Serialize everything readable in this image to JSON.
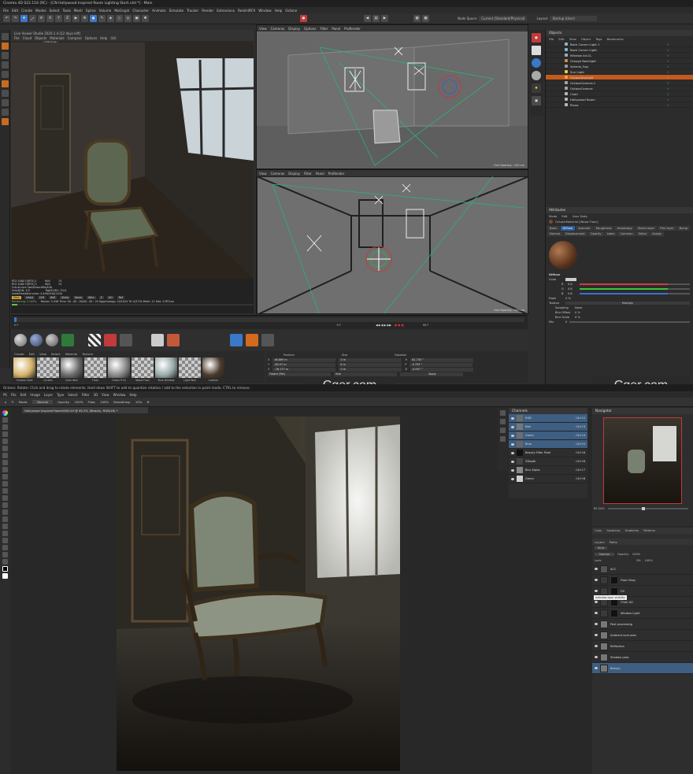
{
  "c4d": {
    "window_title": "Cinema 4D S22.116 (RC) - [CN Hollywood Inspired Room Lighting Start.c4d *] - Main",
    "menu": [
      "File",
      "Edit",
      "Create",
      "Modes",
      "Select",
      "Tools",
      "Mesh",
      "Spline",
      "Volume",
      "MoGraph",
      "Character",
      "Animate",
      "Simulate",
      "Tracker",
      "Render",
      "Extensions",
      "RedshiftFX",
      "Window",
      "Help",
      "Octane"
    ],
    "node_space_label": "Node Space:",
    "node_space_value": "Current (Standard/Physical)",
    "layout_label": "Layout:",
    "layout_value": "Startup (User)",
    "xyz": [
      "X",
      "Y",
      "Z"
    ],
    "live_viewer": {
      "title": "Live Viewer Studio 2020.1.4-[12 days left]",
      "menu": [
        "File",
        "Cloud",
        "Objects",
        "Materials",
        "Compare",
        "Options",
        "Help",
        "GUI"
      ],
      "dropdown": "LDR 8-bit",
      "status": [
        "RTX 2080 Ti[RTX] 1",
        "RTX 2080 Ti[RTX] 2",
        "Out-of-core used/max:0Kb/4Gb",
        "Grey8/16: 1/3",
        "Used/free/total vram: 4.4Gb/5Gb/11Gb"
      ],
      "gpu_pct": [
        "90%",
        "90%"
      ],
      "gpu_temp": [
        "74",
        "74"
      ],
      "rgb_label": "Rgb32/64: 7/1/4",
      "render_tabs": [
        "Main",
        "Infold",
        "Diff",
        "Refl",
        "Shdw",
        "Norm",
        "Wire",
        "Z",
        "AO",
        "Ref"
      ],
      "progress": "Rendering: 2.344%",
      "progress_value": 0.02344,
      "render_stats": "Ms/sec: 5.456   Time: 00 : 00 : 00/00 : 00 : 20   Spp/maxspp: 24/1024   Tri: 0/572k   Mesh: 11   Hair: 0   RTX:on"
    },
    "viewport_top": {
      "menu": [
        "View",
        "Cameras",
        "Display",
        "Options",
        "Filter",
        "Panel",
        "ProRender"
      ],
      "label": "Perspective",
      "camera": "OctaneCamera.1",
      "grid": "Grid Spacing : 100 cm"
    },
    "viewport_bottom": {
      "menu": [
        "View",
        "Cameras",
        "Display",
        "Filter",
        "Panel",
        "ProRender"
      ],
      "label": "Perspective",
      "grid": "Grid Spacing : 100 cm"
    },
    "objects_panel": {
      "title": "Objects",
      "menu": [
        "File",
        "Edit",
        "View",
        "Object",
        "Tags",
        "Bookmarks"
      ],
      "items": [
        {
          "name": "Back Corner Light 1",
          "color": "#8fb1c9"
        },
        {
          "name": "Back Corner Light",
          "color": "#8fb1c9"
        },
        {
          "name": "Window ArLCL",
          "color": "#8fb1c9"
        },
        {
          "name": "Orange Backlight",
          "color": "#d48a3a"
        },
        {
          "name": "Volume_Fog",
          "color": "#9a9a9a"
        },
        {
          "name": "Sun Light",
          "color": "#e6c84c"
        },
        {
          "name": "OctaneDaylight",
          "color": "#e8a43a"
        },
        {
          "name": "OctaneCamera.1",
          "color": "#a5a5a5"
        },
        {
          "name": "OctaneCamera",
          "color": "#a5a5a5"
        },
        {
          "name": "Chair",
          "color": "#b7b7b7"
        },
        {
          "name": "Hollywood Room",
          "color": "#b7b7b7"
        },
        {
          "name": "Plane",
          "color": "#b7b7b7"
        }
      ],
      "selected_index": 6
    },
    "attributes": {
      "title": "Attributes",
      "menu": [
        "Mode",
        "Edit",
        "User Data"
      ],
      "material": "OctaneMaterial [Wood Floor]",
      "tabs_row1": [
        "Basic",
        "Diffuse",
        "Specular",
        "Roughness",
        "Anisotropy",
        "Sheen layer",
        "Film layer"
      ],
      "tabs_row2": [
        "Bump",
        "Normal",
        "Displacement",
        "Opacity",
        "Index",
        "Common",
        "Editor"
      ],
      "tabs_row3": [
        "Assign"
      ],
      "active_tab": "Diffuse",
      "section": "Diffuse",
      "color_label": "Color",
      "rgb": [
        {
          "label": "R",
          "value": "0.8",
          "color": "#d23c3c"
        },
        {
          "label": "G",
          "value": "0.8",
          "color": "#3cc23c"
        },
        {
          "label": "B",
          "value": "0.8",
          "color": "#3c6ed2"
        }
      ],
      "float_label": "Float",
      "float_value": "0 %",
      "texture_label": "Texture",
      "texture_value": "Multiply",
      "sampling_label": "Sampling",
      "sampling_value": "None",
      "blur_offset_label": "Blur Offset",
      "blur_offset_value": "0 %",
      "blur_scale_label": "Blur Scale",
      "blur_scale_value": "0 %",
      "mix_label": "Mix",
      "mix_value": "0"
    },
    "timeline": {
      "start": "0 F",
      "end": "90 F",
      "current": "0 F"
    },
    "material_manager": {
      "menu": [
        "Create",
        "Edit",
        "View",
        "Select",
        "Material",
        "Texture"
      ],
      "materials": [
        "Chrome Gold",
        "Curtain",
        "Dark Wall",
        "Floor",
        "Green Trim",
        "Wood Floor",
        "Blue Window",
        "Light Wall",
        "Leather"
      ]
    },
    "coordinates": {
      "headers": [
        "Position",
        "Size",
        "Rotation"
      ],
      "rows": [
        {
          "axis": "X",
          "pos": "46.869 m",
          "size": "0 m",
          "rot_label": "H",
          "rot": "62.735 °"
        },
        {
          "axis": "Y",
          "pos": "-80.07 m",
          "size": "0 m",
          "rot_label": "P",
          "rot": "-9.793 °"
        },
        {
          "axis": "Z",
          "pos": "-76.177 m",
          "size": "0 m",
          "rot_label": "B",
          "rot": "-0.097 °"
        }
      ],
      "mode": "Object (Rel)",
      "size_mode": "Size",
      "apply": "Apply"
    },
    "status_hint": "Octane: Rotate: Click and drag to rotate elements. Hold down SHIFT to add to quantize rotation / add to the selection in point mode, CTRL to remove."
  },
  "watermarks": [
    "Cger.com",
    "Cger.com"
  ],
  "ps": {
    "menu": [
      "PS",
      "File",
      "Edit",
      "Image",
      "Layer",
      "Type",
      "Select",
      "Filter",
      "3D",
      "View",
      "Window",
      "Help"
    ],
    "options": {
      "mode_label": "Mode:",
      "mode_value": "Normal",
      "opacity_label": "Opacity:",
      "opacity_value": "100%",
      "flow_label": "Flow:",
      "flow_value": "100%",
      "smoothing_label": "Smoothing:",
      "smoothing_value": "10%"
    },
    "doc_tab": "Hollywood Inspired Room0000.tif @ 65.2% (Beauty, RGB/16) *",
    "zoom": "65.24%",
    "channels": {
      "title": "Channels",
      "rows": [
        {
          "name": "RGB",
          "key": "Ctrl+2",
          "sel": true,
          "thumb": "#6b6b6b"
        },
        {
          "name": "Red",
          "key": "Ctrl+3",
          "sel": true,
          "thumb": "#777"
        },
        {
          "name": "Green",
          "key": "Ctrl+4",
          "sel": true,
          "thumb": "#6e6e6e"
        },
        {
          "name": "Blue",
          "key": "Ctrl+5",
          "sel": true,
          "thumb": "#666"
        },
        {
          "name": "Beauty Filter Pixel",
          "key": "Ctrl+6",
          "sel": false,
          "thumb": "#111"
        },
        {
          "name": "ZDepth",
          "key": "Ctrl+6",
          "sel": false,
          "thumb": "#444"
        },
        {
          "name": "Blur Alpha",
          "key": "Ctrl+7",
          "sel": false,
          "thumb": "#888"
        },
        {
          "name": "Green",
          "key": "Ctrl+8",
          "sel": false,
          "thumb": "#cfcfcf"
        }
      ]
    },
    "navigator": {
      "title": "Navigator"
    },
    "panel_tabs": [
      "Color",
      "Swatches",
      "Gradients",
      "Patterns"
    ],
    "layers": {
      "tabs": [
        "Layers",
        "Paths"
      ],
      "kind": "Kind",
      "blend": "Normal",
      "opacity_label": "Opacity:",
      "opacity": "100%",
      "fill_label": "Fill:",
      "fill": "100%",
      "lock_label": "Lock:",
      "tooltip": "Indicates layer visibility",
      "rows": [
        {
          "name": "ACC",
          "sel": false,
          "mask": false
        },
        {
          "name": "Floor Drop",
          "sel": false,
          "mask": true
        },
        {
          "name": "Fill",
          "sel": false,
          "mask": true
        },
        {
          "name": "Chair AO",
          "sel": false,
          "mask": true
        },
        {
          "name": "Window Light",
          "sel": false,
          "mask": true
        },
        {
          "name": "Post processing",
          "sel": false,
          "mask": false
        },
        {
          "name": "Ambient occlusion",
          "sel": false,
          "mask": false
        },
        {
          "name": "Reflection",
          "sel": false,
          "mask": false
        },
        {
          "name": "Shadow pass",
          "sel": false,
          "mask": false
        },
        {
          "name": "Beauty",
          "sel": true,
          "mask": false
        }
      ]
    }
  }
}
